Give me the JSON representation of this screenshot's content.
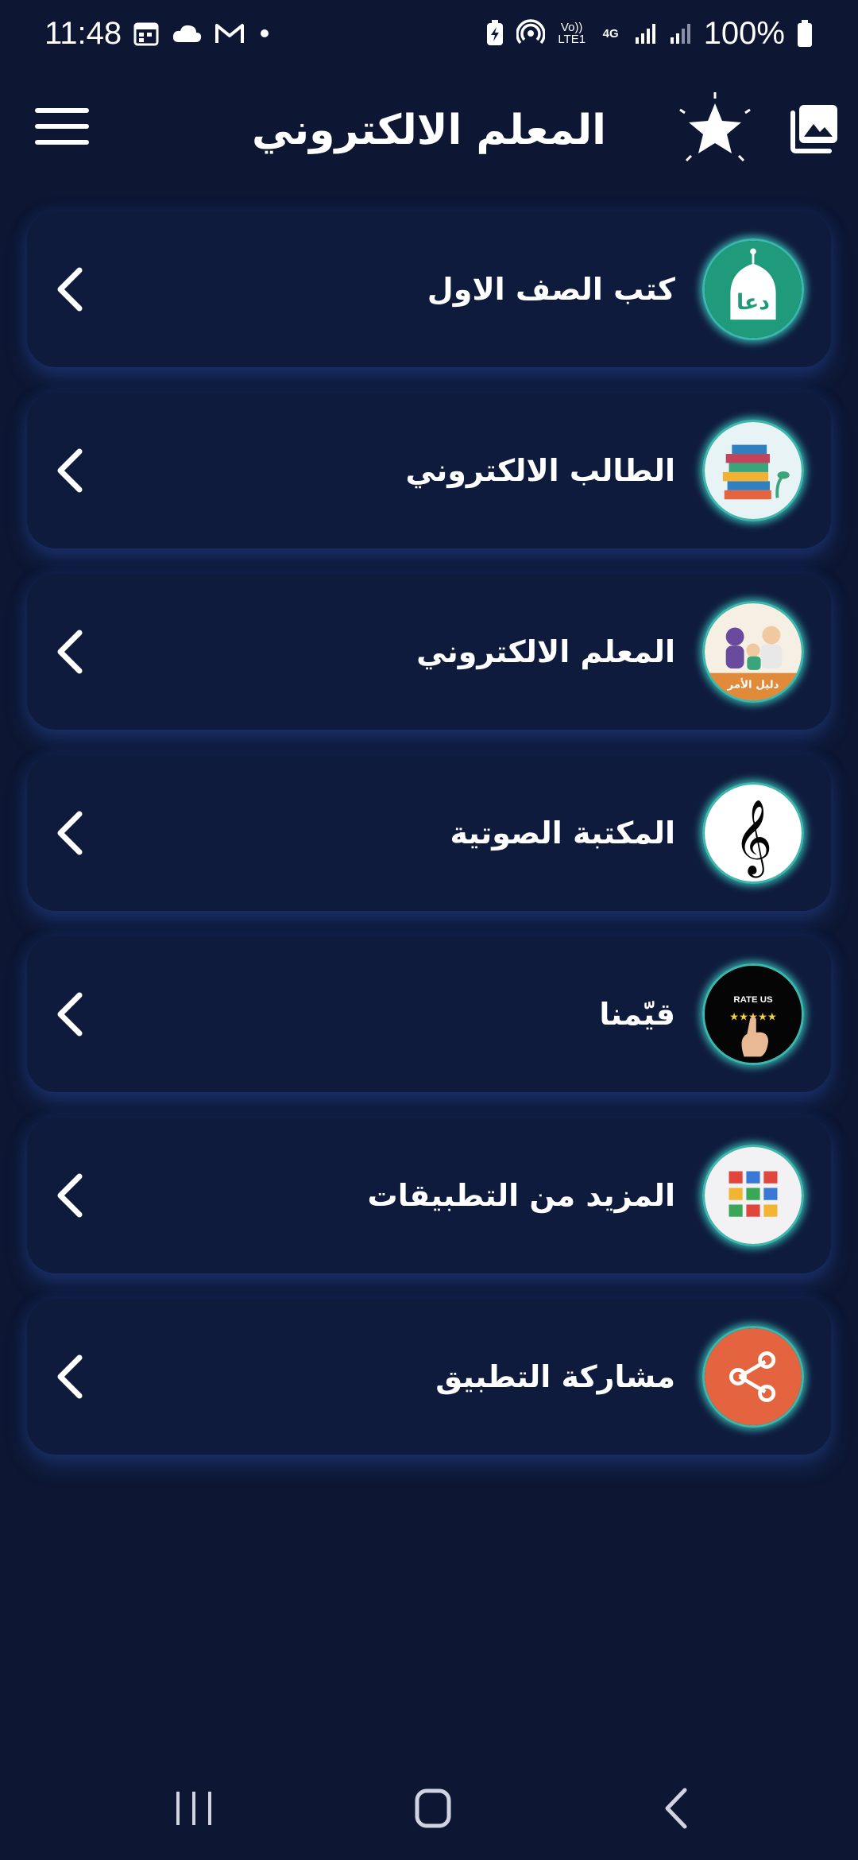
{
  "status_bar": {
    "time": "11:48",
    "battery": "100%",
    "volte_label": "Vo)) LTE1",
    "network_label": "4G",
    "icons_left": [
      "calendar-icon",
      "cloud-icon",
      "gmail-icon",
      "dot-icon"
    ],
    "icons_right": [
      "battery-saver-icon",
      "hotspot-icon",
      "volte-icon",
      "signal-icon",
      "signal-icon",
      "battery-icon"
    ]
  },
  "app_bar": {
    "title": "المعلم  الالكتروني",
    "menu_icon": "hamburger-menu-icon",
    "star_icon": "star-icon",
    "gallery_icon": "gallery-icon"
  },
  "menu": {
    "items": [
      {
        "label": "كتب الصف الاول",
        "icon": "doaa-mosque-icon"
      },
      {
        "label": "الطالب الالكتروني",
        "icon": "books-stack-icon"
      },
      {
        "label": "المعلم الالكتروني",
        "icon": "parents-guide-icon",
        "icon_text": "دليل الأمر"
      },
      {
        "label": "المكتبة الصوتية",
        "icon": "treble-clef-icon"
      },
      {
        "label": "قيّمنا",
        "icon": "rate-us-icon",
        "icon_text": "RATE US"
      },
      {
        "label": "المزيد من التطبيقات",
        "icon": "apps-grid-icon"
      },
      {
        "label": "مشاركة التطبيق",
        "icon": "share-icon"
      }
    ]
  },
  "colors": {
    "background": "#0d1733",
    "card": "#0f1b3d",
    "icon_ring": "#3ab8ac",
    "share_orange": "#e4643f",
    "mosque_green": "#1f9a7a"
  },
  "nav_bar": {
    "recents_icon": "recents-icon",
    "home_icon": "home-icon",
    "back_icon": "back-icon"
  }
}
